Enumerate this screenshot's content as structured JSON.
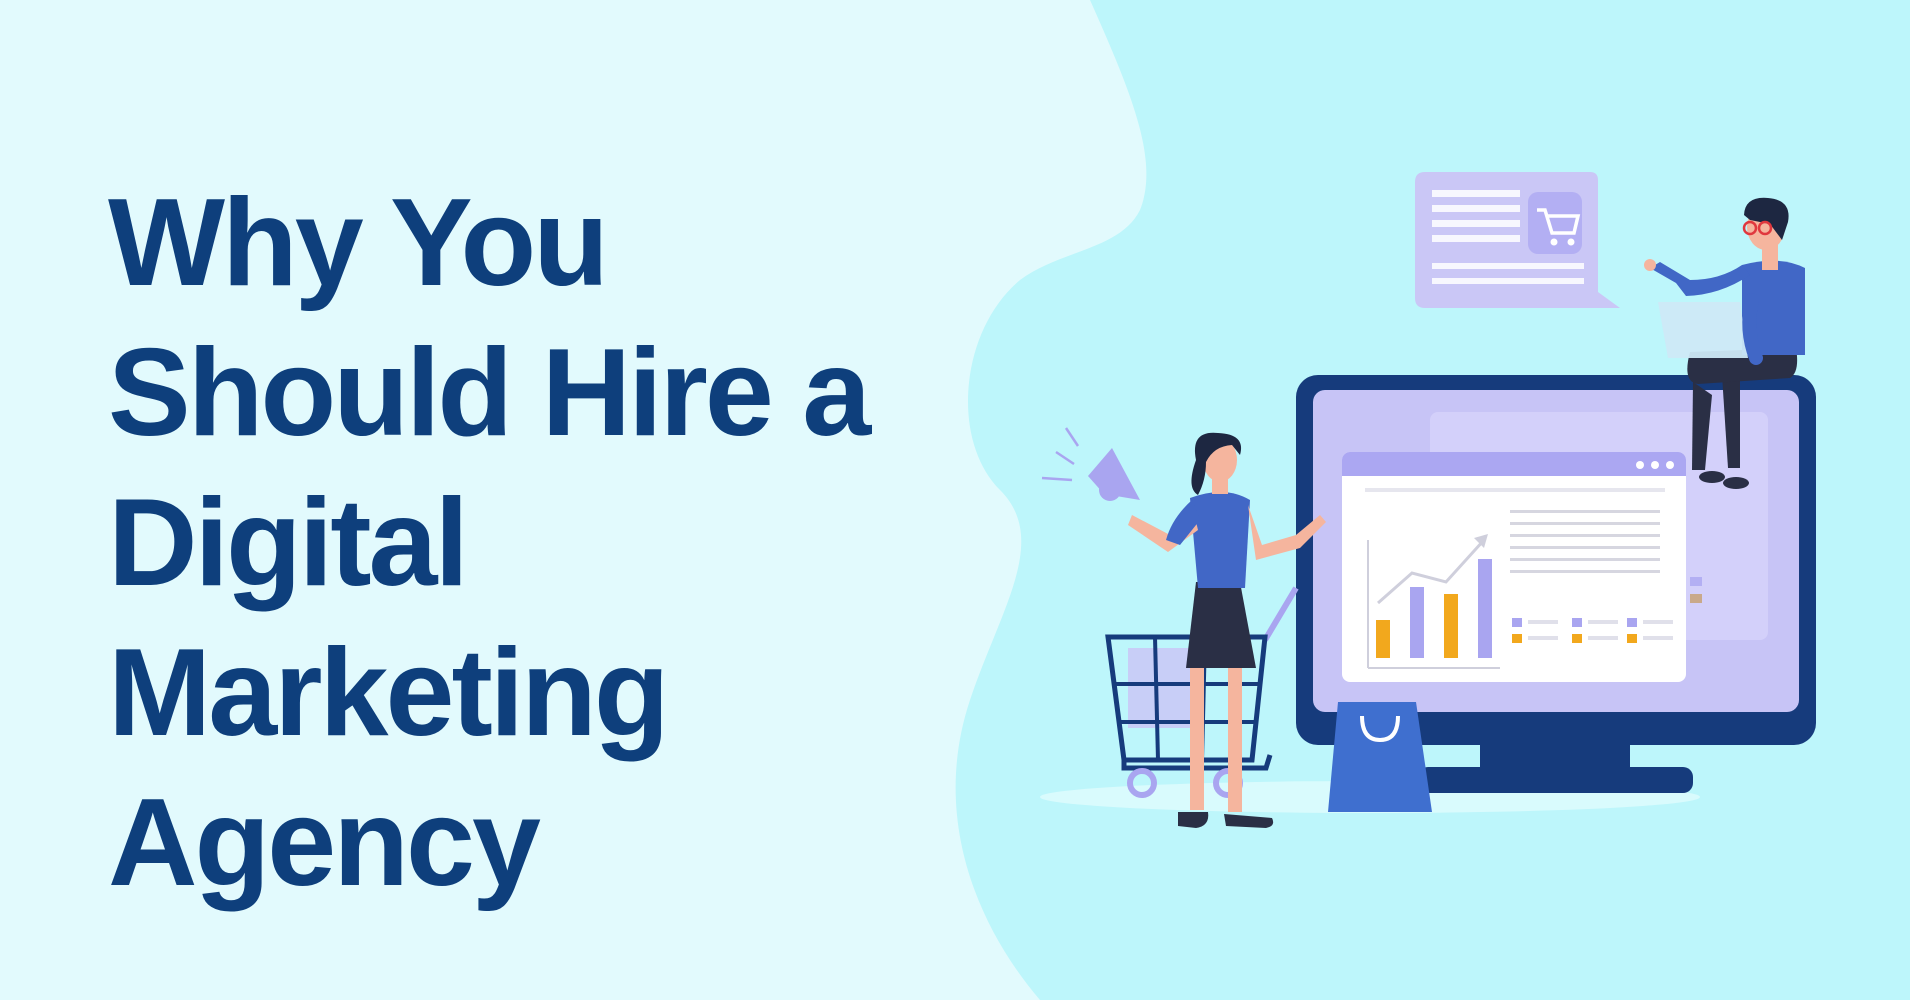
{
  "headline": {
    "lines": [
      "Why You",
      "Should Hire a",
      "Digital",
      "Marketing",
      "Agency"
    ]
  },
  "colors": {
    "background_left": "#e2fafd",
    "background_right": "#bdf6fb",
    "headline": "#0e3f7c",
    "monitor_frame": "#163b7c",
    "screen": "#c7c4f6",
    "bar_orange": "#f2a81d",
    "bar_purple": "#a9a5f0",
    "shirt_blue": "#4167c6"
  },
  "icons": {
    "chat_bubble": "shopping-cart-message-icon",
    "megaphone": "megaphone-icon",
    "trend_arrow": "trend-arrow-icon",
    "shopping_bag": "shopping-bag-icon",
    "shopping_cart": "shopping-cart-icon"
  }
}
